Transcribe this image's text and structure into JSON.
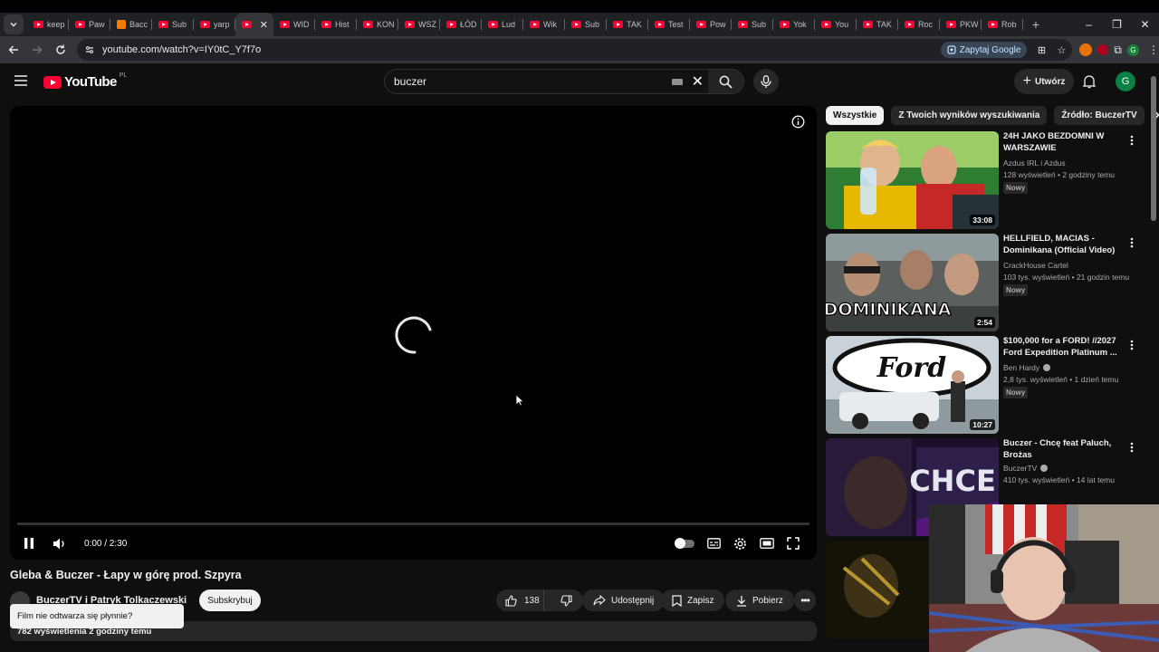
{
  "browser": {
    "tabs": [
      {
        "label": "keep",
        "icon": "youtube-icon"
      },
      {
        "label": "Paw",
        "icon": "youtube-icon"
      },
      {
        "label": "Bacc",
        "icon": "blogger-icon"
      },
      {
        "label": "Sub",
        "icon": "youtube-icon"
      },
      {
        "label": "yarp",
        "icon": "youtube-icon"
      },
      {
        "label": "",
        "icon": "youtube-icon",
        "active": true
      },
      {
        "label": "WID",
        "icon": "youtube-icon"
      },
      {
        "label": "Hist",
        "icon": "youtube-icon"
      },
      {
        "label": "KON",
        "icon": "youtube-icon"
      },
      {
        "label": "WSZ",
        "icon": "youtube-icon"
      },
      {
        "label": "ŁÓD",
        "icon": "youtube-icon"
      },
      {
        "label": "Lud",
        "icon": "youtube-icon"
      },
      {
        "label": "Wik",
        "icon": "youtube-icon"
      },
      {
        "label": "Sub",
        "icon": "youtube-icon"
      },
      {
        "label": "TAK",
        "icon": "youtube-icon"
      },
      {
        "label": "Test",
        "icon": "youtube-icon"
      },
      {
        "label": "Pow",
        "icon": "youtube-icon"
      },
      {
        "label": "Sub",
        "icon": "youtube-icon"
      },
      {
        "label": "Yok",
        "icon": "youtube-icon"
      },
      {
        "label": "You",
        "icon": "youtube-icon"
      },
      {
        "label": "TAK",
        "icon": "youtube-icon"
      },
      {
        "label": "Roc",
        "icon": "youtube-icon"
      },
      {
        "label": "PKW",
        "icon": "youtube-icon"
      },
      {
        "label": "Rob",
        "icon": "youtube-icon"
      }
    ],
    "url": "youtube.com/watch?v=IY0tC_Y7f7o",
    "ask_google": "Zapytaj Google"
  },
  "masthead": {
    "logo_text": "YouTube",
    "region": "PL",
    "search_value": "buczer",
    "create_label": "Utwórz",
    "account_initial": "G"
  },
  "player": {
    "time": "0:00 / 2:30",
    "state": "loading",
    "progress": 0
  },
  "video": {
    "title": "Gleba & Buczer - Łapy w górę prod. Szpyra",
    "channel": "BuczerTV",
    "channel_suffix": "i Patryk Tolkaczewski",
    "subscribe_label": "Subskrybuj",
    "likes": "138",
    "share_label": "Udostępnij",
    "save_label": "Zapisz",
    "download_label": "Pobierz",
    "meta": "782 wyświetlenia  2 godziny temu",
    "toast": "Film nie odtwarza się płynnie?"
  },
  "sidebar": {
    "chips": [
      "Wszystkie",
      "Z Twoich wyników wyszukiwania",
      "Źródło: BuczerTV"
    ],
    "recommendations": [
      {
        "title": "24H JAKO BEZDOMNI W WARSZAWIE",
        "channel": "Azdus IRL i Azdus",
        "verified": false,
        "stats": "128 wyświetleń • 2 godziny temu",
        "badge": "Nowy",
        "duration": "33:08"
      },
      {
        "title": "HELLFIELD, MACIAS - Dominikana (Official Video)",
        "channel": "CrackHouse Cartel",
        "verified": false,
        "stats": "103 tys. wyświetleń • 21 godzin temu",
        "badge": "Nowy",
        "duration": "2:54"
      },
      {
        "title": "$100,000 for a FORD! //2027 Ford Expedition Platinum ...",
        "channel": "Ben Hardy",
        "verified": true,
        "stats": "2,8 tys. wyświetleń • 1 dzień temu",
        "badge": "Nowy",
        "duration": "10:27"
      },
      {
        "title": "Buczer - Chcę feat Paluch, Brożas",
        "channel": "BuczerTV",
        "verified": true,
        "stats": "410 tys. wyświetleń • 14 lat temu",
        "badge": "",
        "duration": ""
      }
    ],
    "thumb_texts": {
      "ford": "Ford",
      "dominikana": "DOMINIKANA",
      "chce": "CHCE"
    }
  },
  "colors": {
    "accent": "#ff0033",
    "background": "#0f0f0f",
    "chip": "#272727"
  }
}
